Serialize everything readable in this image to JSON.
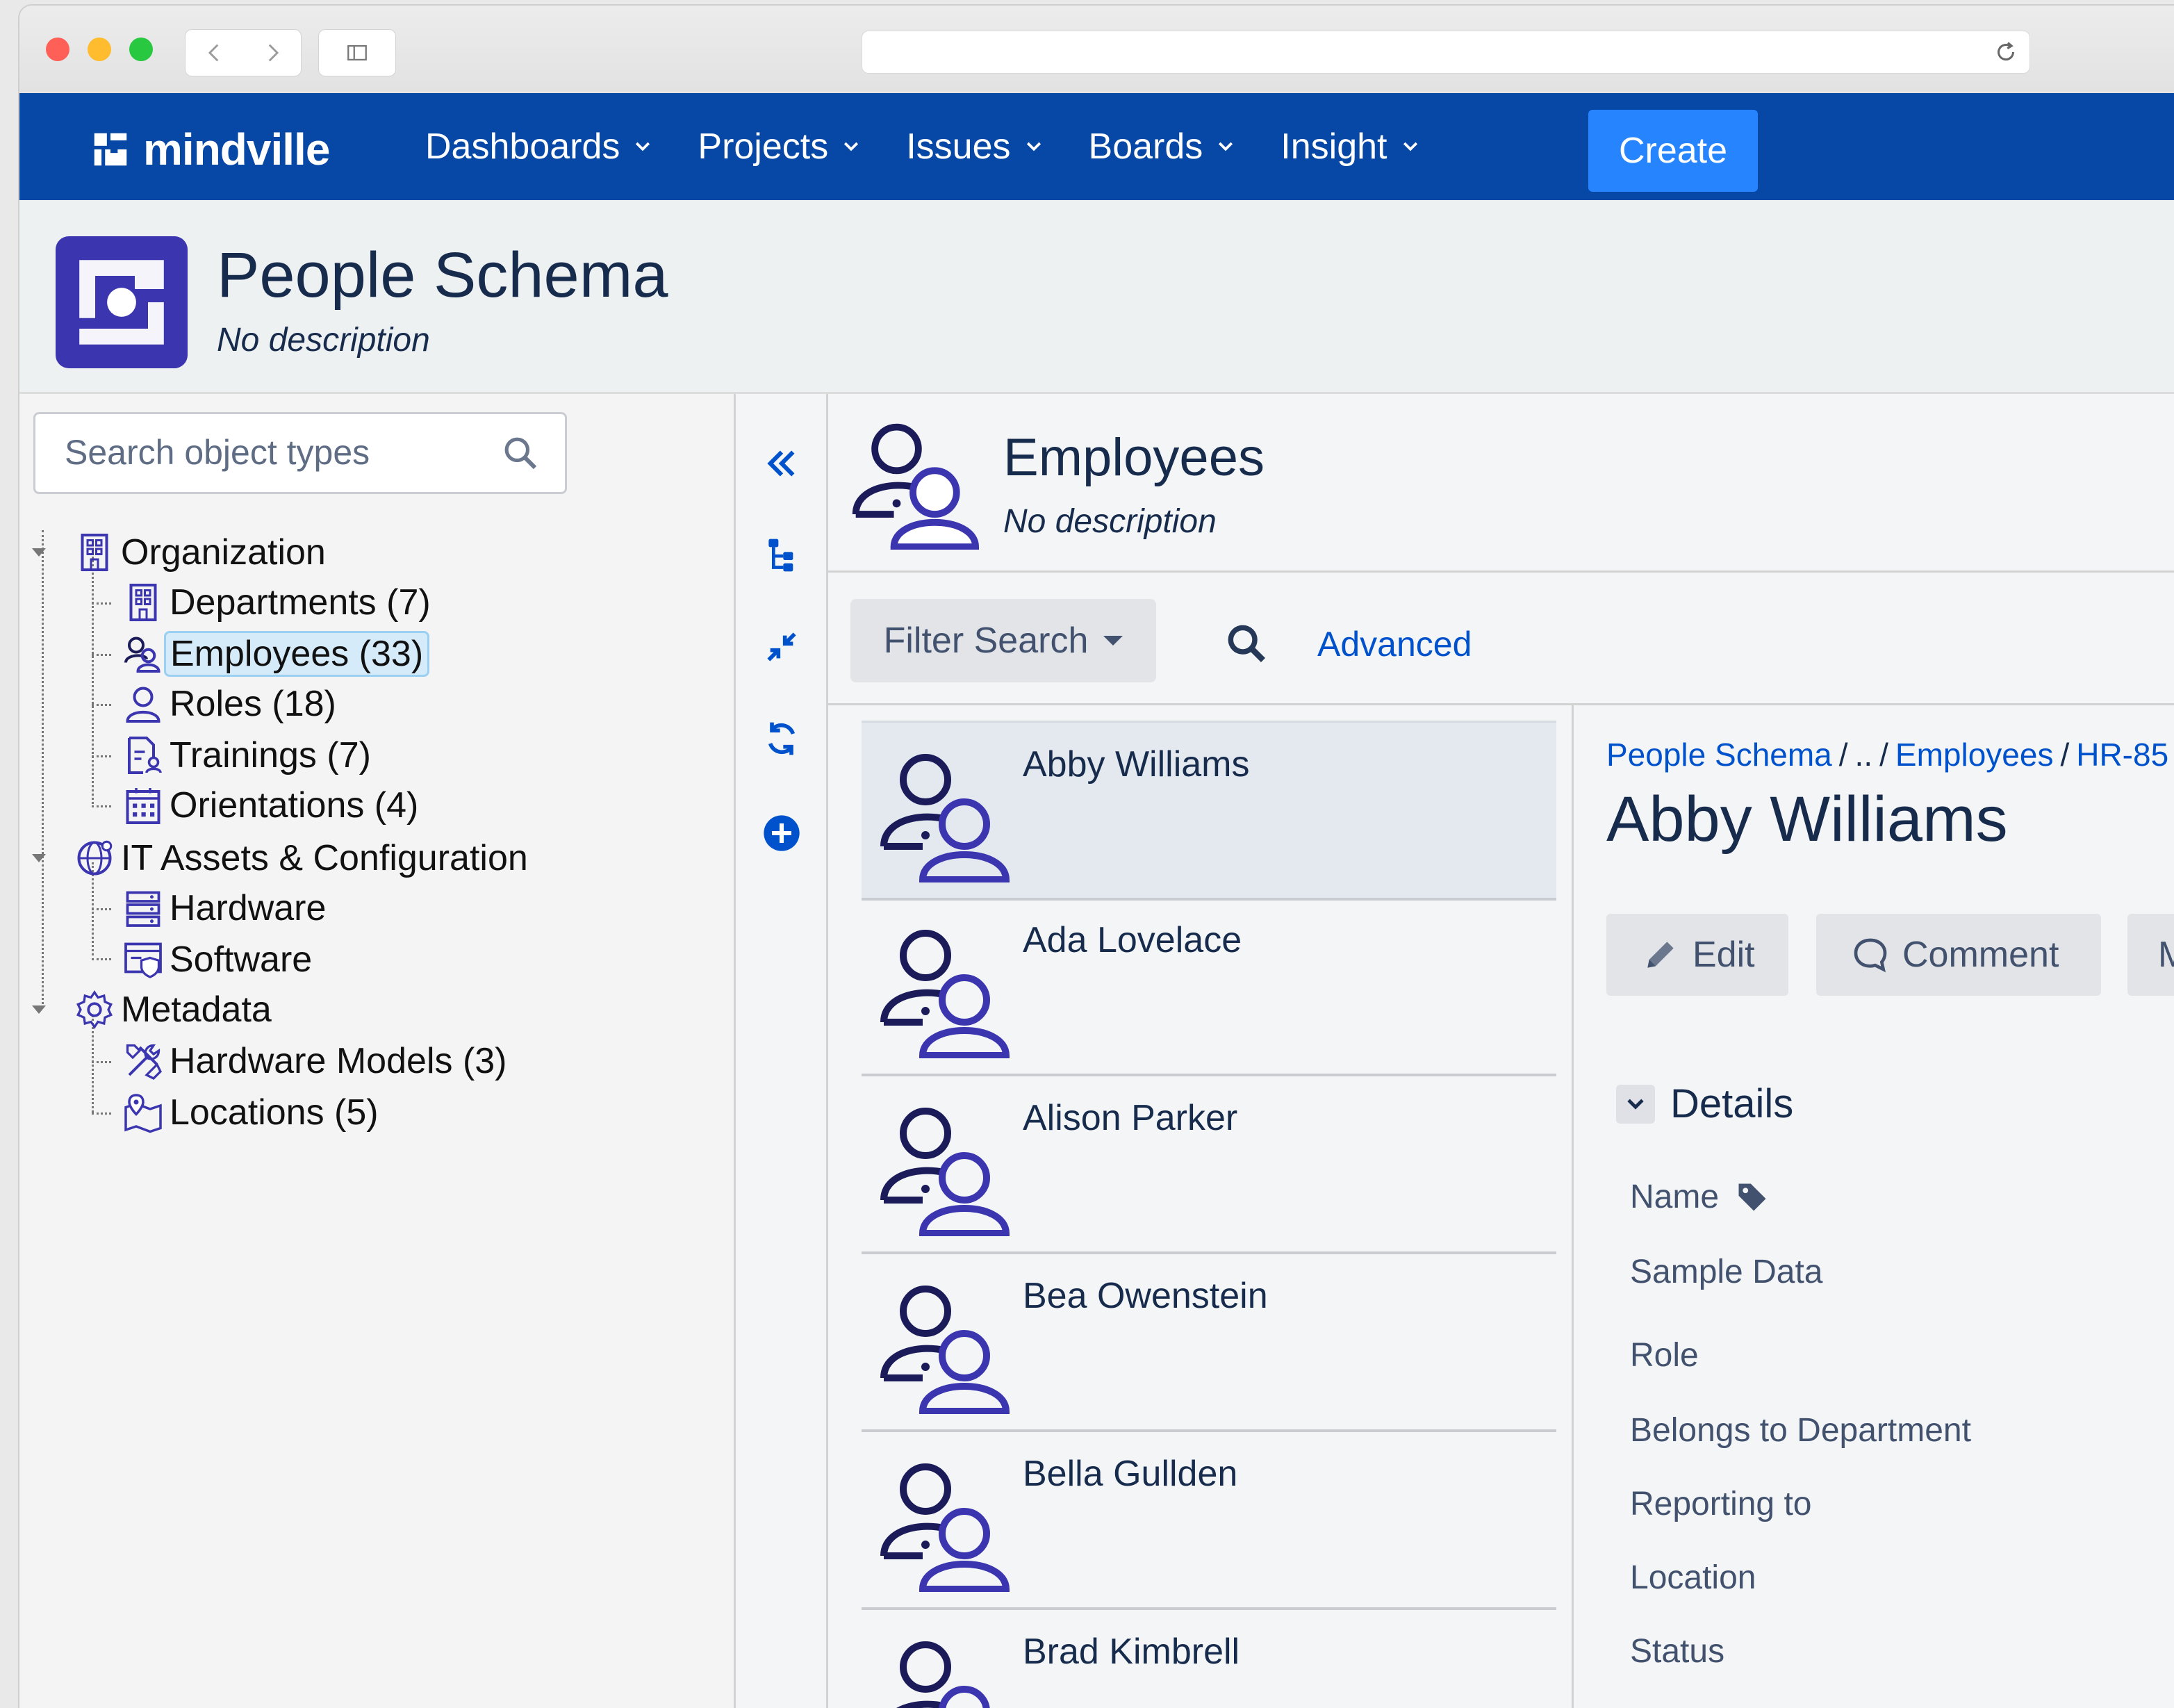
{
  "app": {
    "brand": "mindville",
    "menu": [
      {
        "label": "Dashboards"
      },
      {
        "label": "Projects"
      },
      {
        "label": "Issues"
      },
      {
        "label": "Boards"
      },
      {
        "label": "Insight"
      }
    ],
    "create_label": "Create",
    "accent_color": "#0747a6",
    "create_color": "#2684ff"
  },
  "schema": {
    "title": "People Schema",
    "description": "No description"
  },
  "sidebar": {
    "search_placeholder": "Search object types",
    "tree": [
      {
        "label": "Organization",
        "icon": "building-icon",
        "level": 0
      },
      {
        "label": "Departments (7)",
        "icon": "building-icon",
        "level": 1
      },
      {
        "label": "Employees (33)",
        "icon": "people-icon",
        "level": 1,
        "selected": true
      },
      {
        "label": "Roles (18)",
        "icon": "user-icon",
        "level": 1
      },
      {
        "label": "Trainings (7)",
        "icon": "document-user-icon",
        "level": 1
      },
      {
        "label": "Orientations (4)",
        "icon": "calendar-icon",
        "level": 1
      },
      {
        "label": "IT Assets & Configuration",
        "icon": "globe-icon",
        "level": 0
      },
      {
        "label": "Hardware",
        "icon": "server-icon",
        "level": 1
      },
      {
        "label": "Software",
        "icon": "browser-shield-icon",
        "level": 1
      },
      {
        "label": "Metadata",
        "icon": "gear-icon",
        "level": 0
      },
      {
        "label": "Hardware Models (3)",
        "icon": "tools-icon",
        "level": 1
      },
      {
        "label": "Locations (5)",
        "icon": "map-pin-icon",
        "level": 1
      }
    ]
  },
  "object_type": {
    "title": "Employees",
    "description": "No description"
  },
  "filter": {
    "button_label": "Filter Search",
    "advanced_label": "Advanced"
  },
  "employees": [
    {
      "name": "Abby Williams",
      "selected": true
    },
    {
      "name": "Ada Lovelace"
    },
    {
      "name": "Alison Parker"
    },
    {
      "name": "Bea Owenstein"
    },
    {
      "name": "Bella Gullden"
    },
    {
      "name": "Brad Kimbrell"
    }
  ],
  "detail": {
    "breadcrumb": [
      "People Schema",
      "..",
      "Employees",
      "HR-85"
    ],
    "title": "Abby Williams",
    "buttons": {
      "edit": "Edit",
      "comment": "Comment",
      "more": "M"
    },
    "section_title": "Details",
    "attributes": [
      "Name",
      "Sample Data",
      "Role",
      "Belongs to Department",
      "Reporting to",
      "Location",
      "Status"
    ]
  }
}
